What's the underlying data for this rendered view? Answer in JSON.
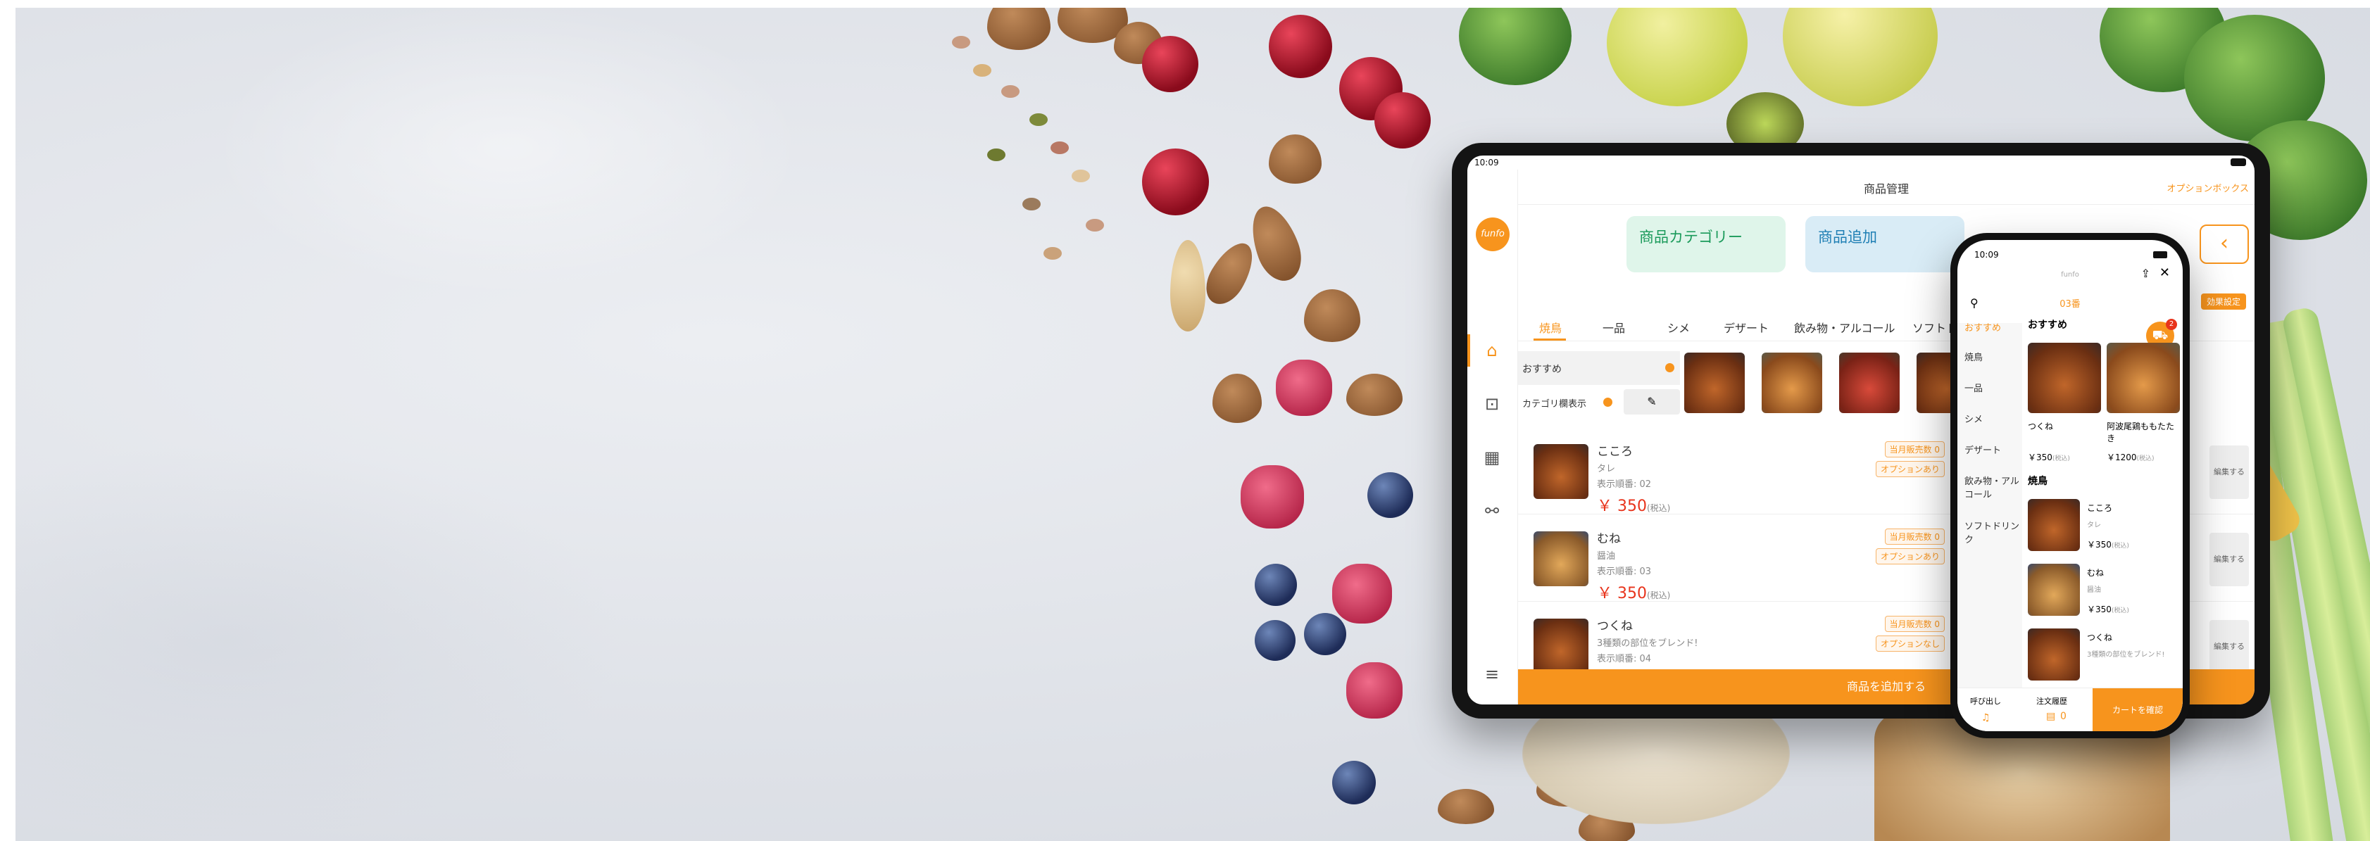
{
  "tablet": {
    "time": "10:09",
    "header_title": "商品管理",
    "header_action": "オプションボックス",
    "logo_text": "funfo",
    "cards": [
      {
        "label": "商品カテゴリー"
      },
      {
        "label": "商品追加"
      }
    ],
    "right_button": "効果設定",
    "tabs": [
      "焼鳥",
      "一品",
      "シメ",
      "デザート",
      "飲み物・アルコール",
      "ソフトドリンク"
    ],
    "featured_label": "おすすめ",
    "category_toggle_label": "カテゴリ欄表示",
    "products": [
      {
        "name": "こころ",
        "sub": "タレ",
        "order": "表示順番: 02",
        "price": "￥ 350",
        "tax": "(税込)",
        "sold": "当月販売数 0",
        "option": "オプションあり"
      },
      {
        "name": "むね",
        "sub": "醤油",
        "order": "表示順番: 03",
        "price": "￥ 350",
        "tax": "(税込)",
        "sold": "当月販売数 0",
        "option": "オプションあり"
      },
      {
        "name": "つくね",
        "sub": "3種類の部位をブレンド!",
        "order": "表示順番: 04",
        "price": "",
        "tax": "",
        "sold": "当月販売数 0",
        "option": "オプションなし"
      }
    ],
    "edit_label": "編集する",
    "bottom_button": "商品を追加する"
  },
  "phone": {
    "time": "10:09",
    "shop": "funfo",
    "table": "03番",
    "categories": [
      "おすすめ",
      "焼鳥",
      "一品",
      "シメ",
      "デザート",
      "飲み物・アルコール",
      "ソフトドリンク"
    ],
    "section_featured": "おすすめ",
    "featured": [
      {
        "name": "つくね",
        "price": "￥350",
        "tax": "(税込)"
      },
      {
        "name": "阿波尾鶏ももたたき",
        "price": "￥1200",
        "tax": "(税込)"
      }
    ],
    "section_list": "焼鳥",
    "list": [
      {
        "name": "こころ",
        "sub": "タレ",
        "price": "￥350",
        "tax": "(税込)"
      },
      {
        "name": "むね",
        "sub": "醤油",
        "price": "￥350",
        "tax": "(税込)"
      },
      {
        "name": "つくね",
        "sub": "3種類の部位をブレンド!",
        "price": "",
        "tax": ""
      }
    ],
    "cart_count": "2",
    "call_label": "呼び出し",
    "history_label": "注文履歴",
    "history_count": "0",
    "cart_button": "カートを確認"
  },
  "colors": {
    "accent": "#f7941d",
    "price": "#e8341c"
  }
}
